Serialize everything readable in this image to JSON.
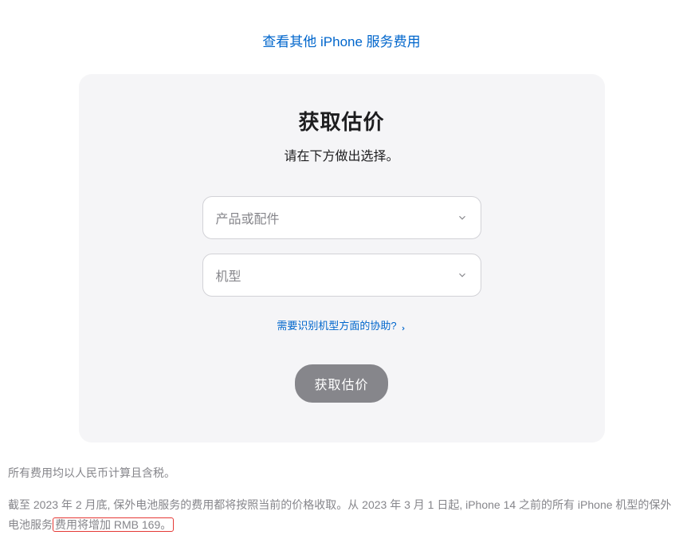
{
  "topLink": "查看其他 iPhone 服务费用",
  "card": {
    "title": "获取估价",
    "subtitle": "请在下方做出选择。",
    "select1": {
      "placeholder": "产品或配件"
    },
    "select2": {
      "placeholder": "机型"
    },
    "helpLink": "需要识别机型方面的协助?",
    "submitButton": "获取估价"
  },
  "footer": {
    "line1": "所有费用均以人民币计算且含税。",
    "line2_part1": "截至 2023 年 2 月底, 保外电池服务的费用都将按照当前的价格收取。从 2023 年 3 月 1 日起, iPhone 14 之前的所有 iPhone 机型的保外电池服务",
    "line2_highlight": "费用将增加 RMB 169。"
  }
}
